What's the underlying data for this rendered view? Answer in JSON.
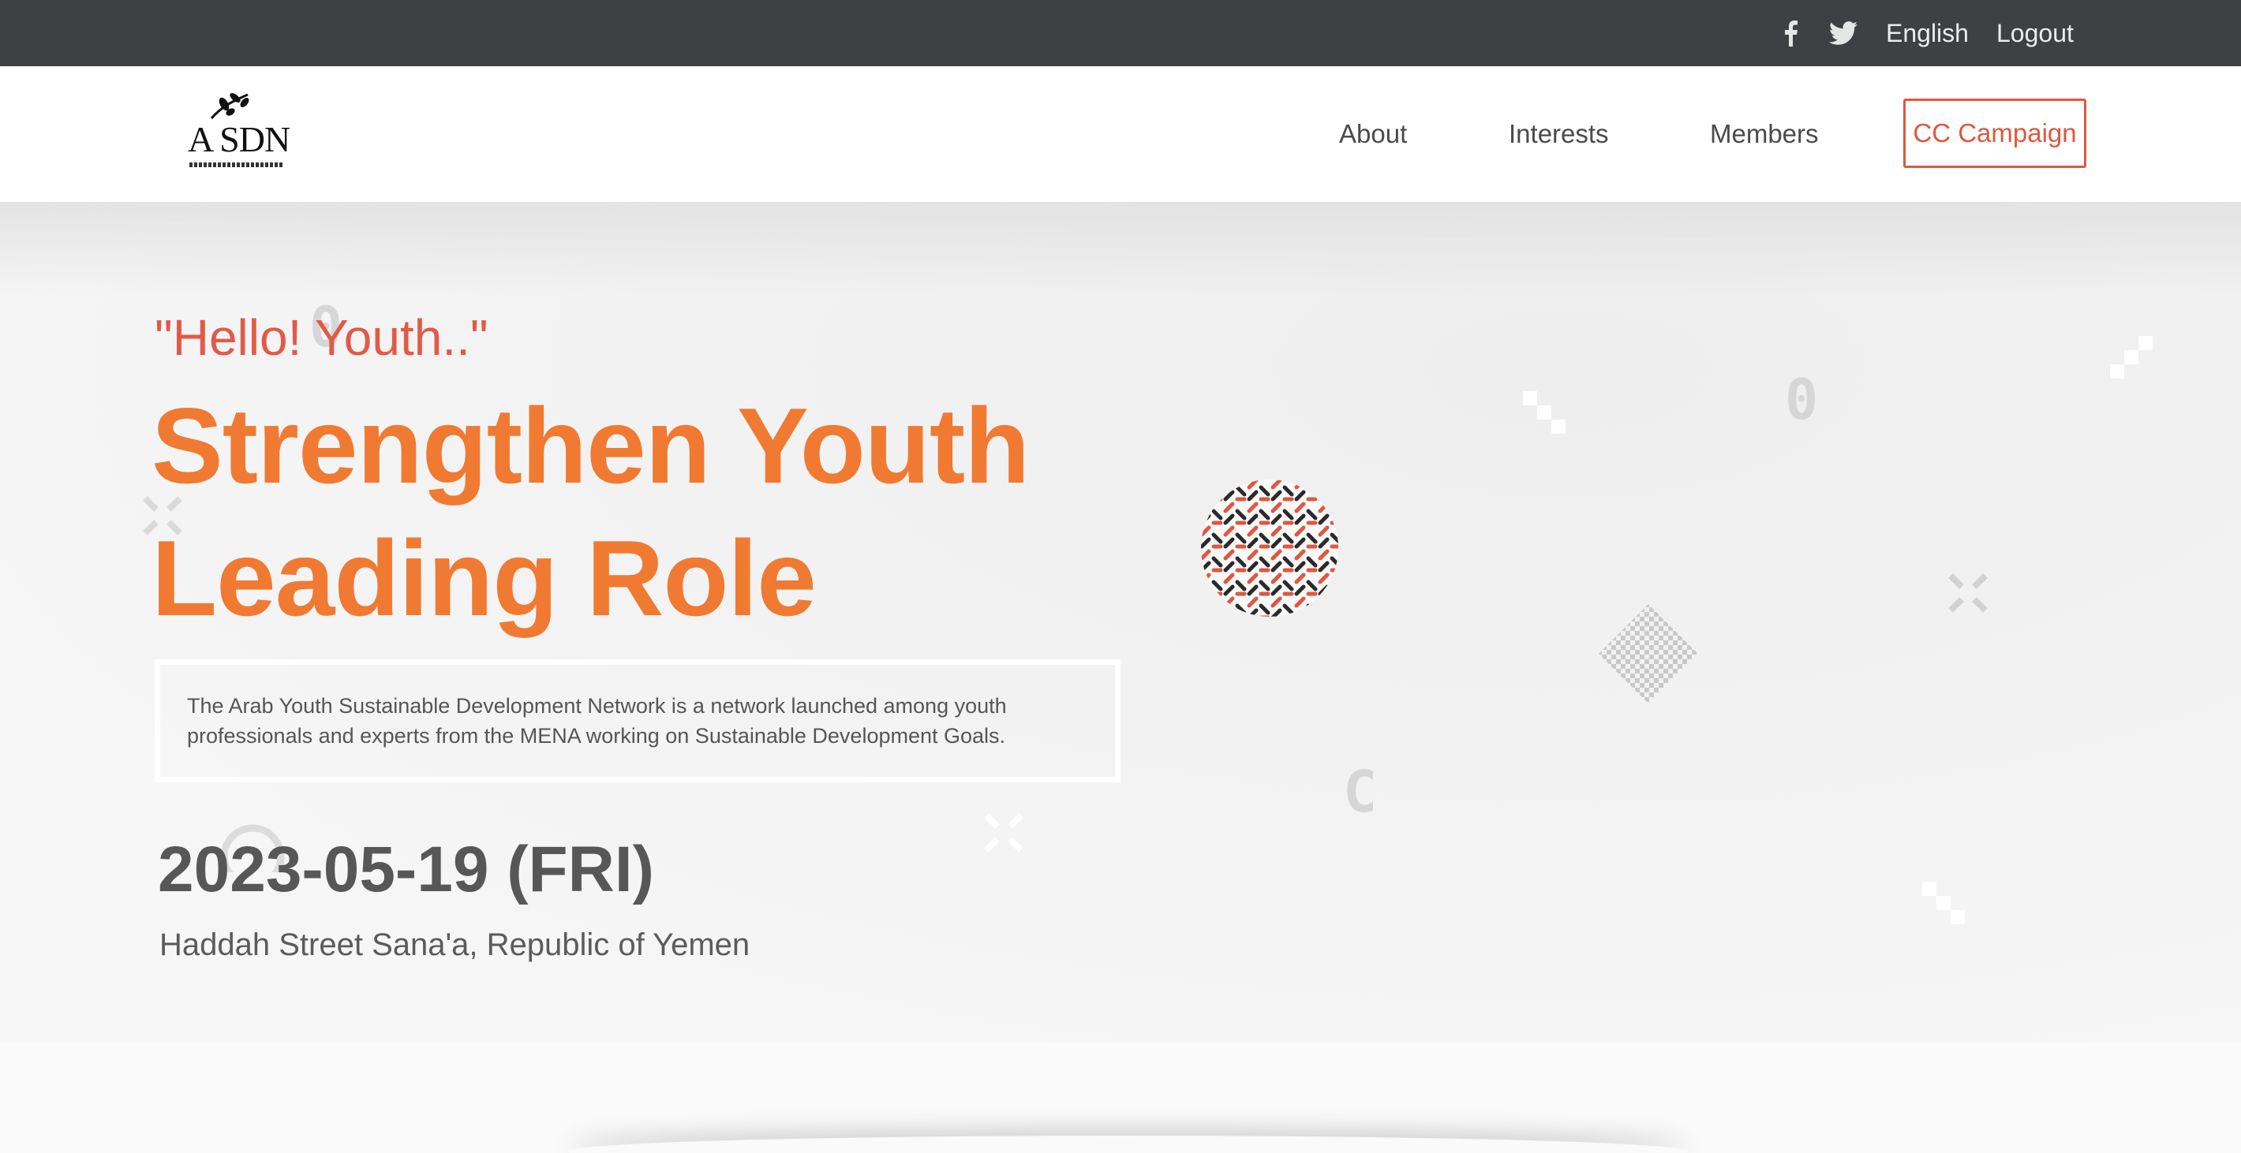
{
  "topbar": {
    "icons": [
      "facebook-icon",
      "twitter-icon"
    ],
    "language": "English",
    "logout": "Logout"
  },
  "nav": {
    "logo_text": "A SDN",
    "items": [
      {
        "label": "About"
      },
      {
        "label": "Interests"
      },
      {
        "label": "Members"
      }
    ],
    "cta": "CC Campaign"
  },
  "hero": {
    "tagline": "\"Hello! Youth..\"",
    "headline_line1": "Strengthen Youth",
    "headline_line2": "Leading Role",
    "description": "The Arab Youth Sustainable Development Network is a network launched among youth professionals and experts from the MENA working on Sustainable Development Goals.",
    "date": "2023-05-19 (FRI)",
    "location": "Haddah Street Sana'a, Republic of Yemen"
  },
  "colors": {
    "topbar_bg": "#3f4044",
    "accent_orange": "#f07a32",
    "accent_red": "#e0573f",
    "text_dark": "#575757"
  }
}
